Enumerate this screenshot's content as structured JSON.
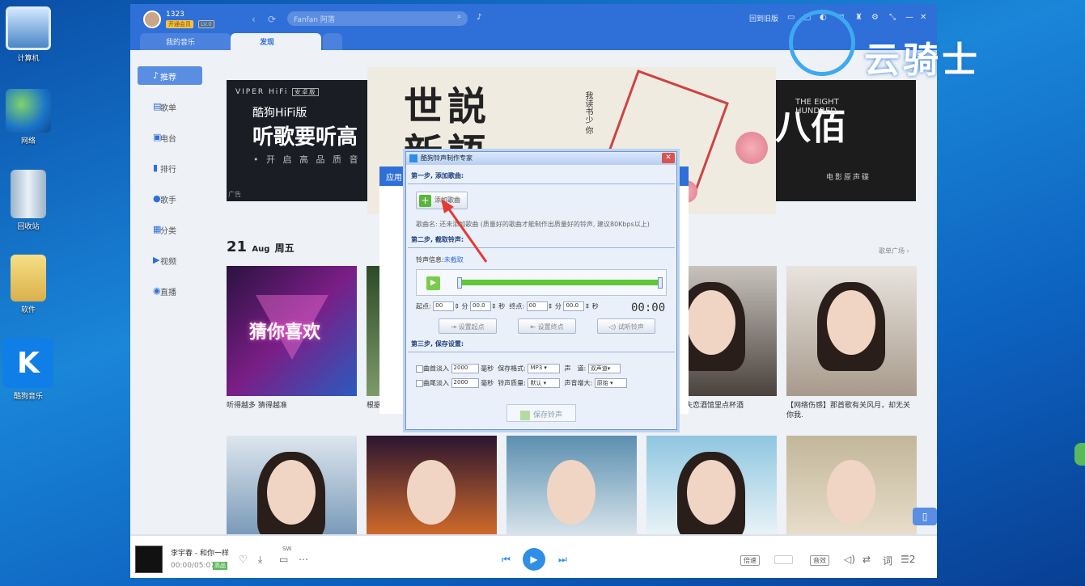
{
  "desktop": {
    "icons": [
      {
        "label": "计算机",
        "icon": "computer-icon"
      },
      {
        "label": "网络",
        "icon": "network-icon"
      },
      {
        "label": "回收站",
        "icon": "recycle-bin-icon"
      },
      {
        "label": "软件",
        "icon": "folder-icon"
      },
      {
        "label": "酷狗音乐",
        "icon": "kugou-icon"
      }
    ]
  },
  "watermark": {
    "text": "云骑士"
  },
  "app": {
    "user": {
      "name": "1323",
      "vip": "开通会员",
      "level": "LV.0"
    },
    "search": {
      "placeholder": "Fanfan 阿落"
    },
    "header": {
      "back_old": "回到旧版"
    },
    "tabs": [
      "我的音乐",
      "发现"
    ],
    "sidebar": [
      "推荐",
      "歌单",
      "电台",
      "排行",
      "歌手",
      "分类",
      "视频",
      "直播"
    ],
    "banner_left": {
      "brand": "VIPER HiFi",
      "badge": "安卓版",
      "line1": "酷狗HiFi版",
      "line2": "听歌要听高",
      "line3": "• 开 启 高 品 质 音",
      "ad": "广告"
    },
    "banner_center": {
      "text": "世説新語",
      "vertical": "我读书少 你"
    },
    "banner_right": {
      "big": "八佰",
      "en": "THE EIGHT HUNDRED",
      "sub": "电影原声碟"
    },
    "date": {
      "day": "21",
      "month": "Aug",
      "weekday": "周五"
    },
    "more": "歌单广场 ›",
    "cards_row1": [
      {
        "title": "猜你喜欢",
        "caption": "听得越多 猜得越准"
      },
      {
        "caption": "根据"
      },
      {
        "caption": ""
      },
      {
        "caption": "失恋酒馆里点杯酒"
      },
      {
        "caption": "【网络伤感】那首歌有关风月，却无关你我."
      }
    ],
    "bottom": {
      "song": "李宇春 - 和你一样",
      "time": "00:00/05:07",
      "tag": "高品",
      "speed": "倍速",
      "quality": "音效",
      "lyric": "词",
      "queue": "2",
      "sw": "SW"
    },
    "dialog_back": {
      "title": "应用"
    }
  },
  "dialog": {
    "title": "酷狗铃声制作专家",
    "step1": "第一步, 添加歌曲:",
    "add_button": "添加歌曲",
    "song_name": "歌曲名: 还未添加歌曲    (质量好的歌曲才能制作出质量好的铃声, 建议80Kbps以上)",
    "step2": "第二步, 截取铃声:",
    "ring_info_label": "铃声信息:",
    "ring_info_value": "未截取",
    "start_label": "起点:",
    "end_label": "终点:",
    "min": "分",
    "sec": "秒",
    "start_min": "00",
    "start_sec": "00.0",
    "end_min": "00",
    "end_sec": "00.0",
    "time_display": "00:00",
    "set_start": "设置起点",
    "set_end": "设置终点",
    "preview": "试听铃声",
    "step3": "第三步, 保存设置:",
    "fade_in": "曲首淡入",
    "fade_out": "曲尾淡入",
    "fade_in_ms": "2000",
    "fade_out_ms": "2000",
    "ms": "毫秒",
    "format_label": "保存格式:",
    "format_value": "MP3",
    "quality_label": "铃声质量:",
    "quality_value": "默认",
    "channel_label": "声　道:",
    "channel_value": "双声道",
    "gain_label": "声音增大:",
    "gain_value": "原始",
    "save_button": "保存铃声"
  }
}
